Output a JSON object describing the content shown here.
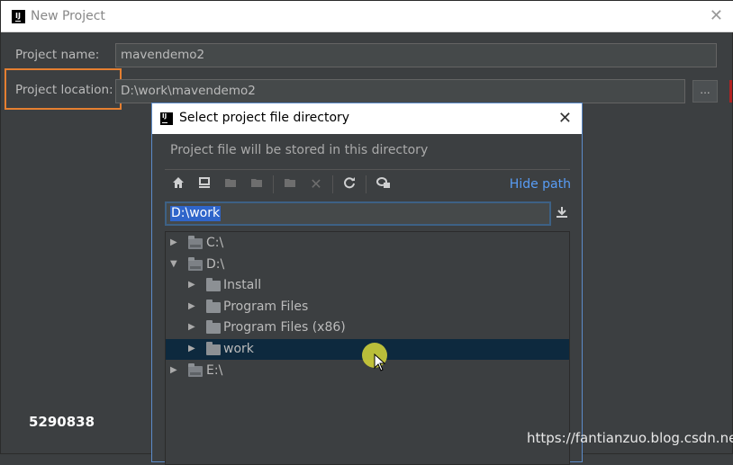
{
  "window": {
    "title": "New Project",
    "close_glyph": "✕"
  },
  "form": {
    "name_label": "Project name:",
    "name_value": "mavendemo2",
    "location_label": "Project location:",
    "location_value": "D:\\work\\mavendemo2",
    "browse_label": "..."
  },
  "dialog": {
    "title": "Select project file directory",
    "close_glyph": "✕",
    "description": "Project file will be stored in this directory",
    "hide_path_label": "Hide path",
    "path_value": "D:\\work",
    "toolbar_icons": [
      "home-icon",
      "desktop-icon",
      "project-folder-icon",
      "module-folder-icon",
      "new-folder-icon",
      "delete-icon",
      "refresh-icon",
      "show-hidden-icon"
    ],
    "tree": [
      {
        "label": "C:\\",
        "expanded": false,
        "level": 0,
        "drive": true
      },
      {
        "label": "D:\\",
        "expanded": true,
        "level": 0,
        "drive": true
      },
      {
        "label": "Install",
        "expanded": false,
        "level": 1,
        "drive": false
      },
      {
        "label": "Program Files",
        "expanded": false,
        "level": 1,
        "drive": false
      },
      {
        "label": "Program Files (x86)",
        "expanded": false,
        "level": 1,
        "drive": false
      },
      {
        "label": "work",
        "expanded": false,
        "level": 1,
        "drive": false,
        "selected": true
      },
      {
        "label": "E:\\",
        "expanded": false,
        "level": 0,
        "drive": true
      }
    ]
  },
  "overlay": {
    "id_text": "5290838",
    "url_text": "https://fantianzuo.blog.csdn.net"
  },
  "colors": {
    "accent": "#589df6",
    "highlight_box": "#e57f31",
    "selection": "#0d293e"
  }
}
